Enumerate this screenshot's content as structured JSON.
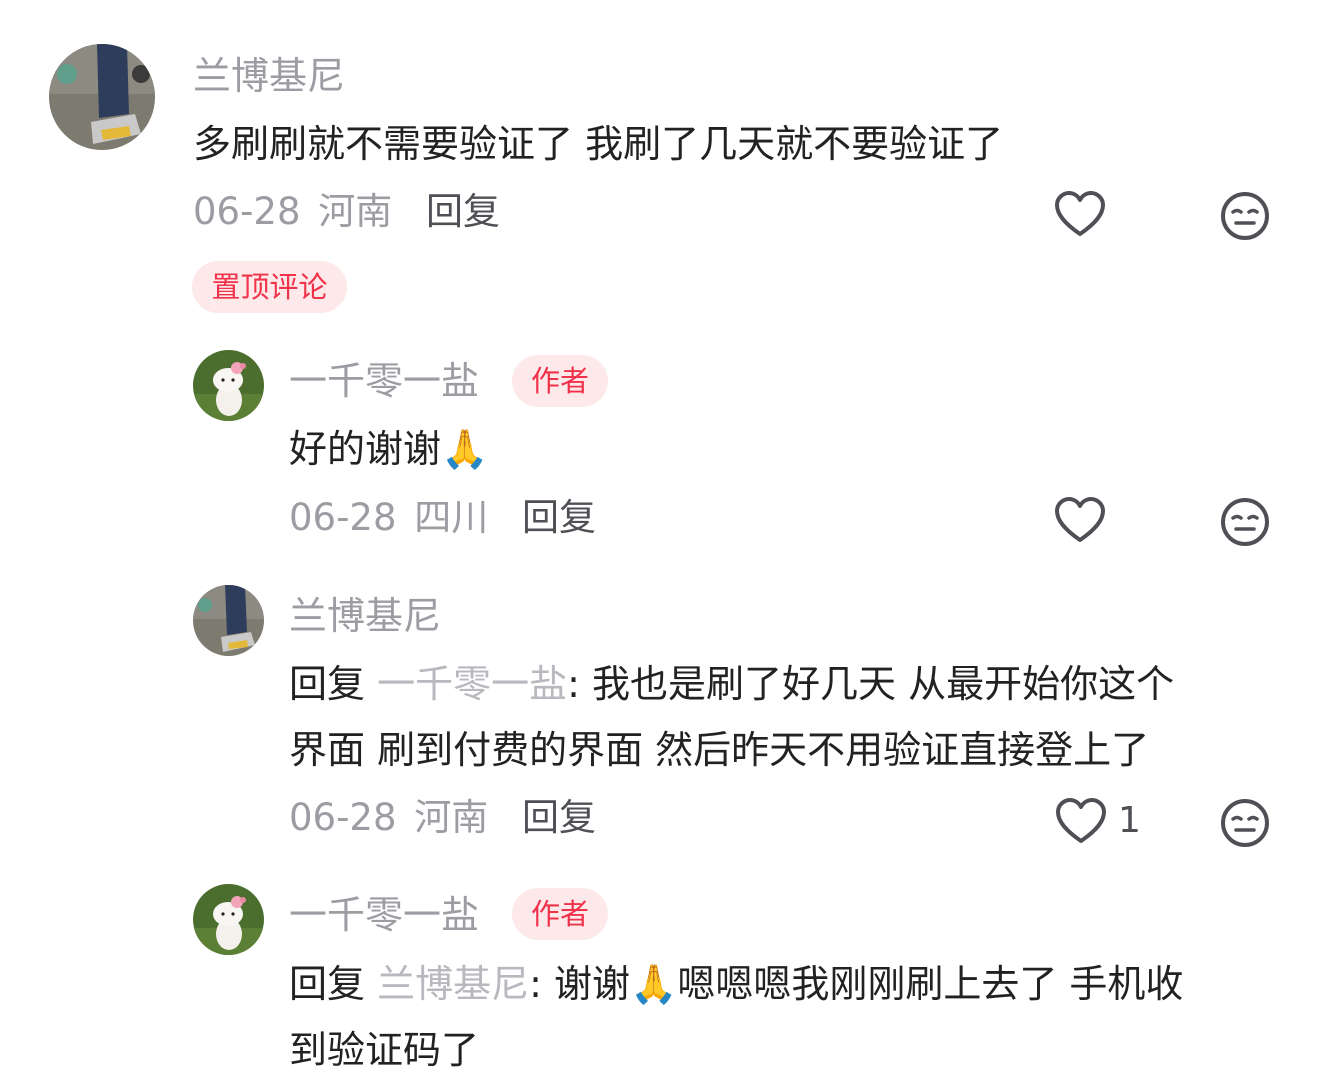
{
  "colors": {
    "text": "#222222",
    "muted": "#9c9ca3",
    "mention": "#b8b8be",
    "accent_red": "#f0324b",
    "badge_bg": "#fde9ea",
    "icon": "#4f4f55"
  },
  "icons": {
    "like": "heart-outline-icon",
    "dislike": "neutral-face-icon",
    "emoji": "folded-hands-emoji"
  },
  "comments": [
    {
      "author": "兰博基尼",
      "text": "多刷刷就不需要验证了 我刷了几天就不要验证了",
      "date": "06-28",
      "location": "河南",
      "reply_label": "回复",
      "pinned_label": "置顶评论",
      "like_count": ""
    },
    {
      "author": "一千零一盐",
      "author_badge": "作者",
      "text": "好的谢谢",
      "emoji": "🙏",
      "date": "06-28",
      "location": "四川",
      "reply_label": "回复",
      "like_count": ""
    },
    {
      "author": "兰博基尼",
      "reply_prefix": "回复",
      "mention": "一千零一盐",
      "text_line1": ": 我也是刷了好几天 从最开始你这个",
      "text_line2": "界面 刷到付费的界面 然后昨天不用验证直接登上了",
      "date": "06-28",
      "location": "河南",
      "reply_label": "回复",
      "like_count": "1"
    },
    {
      "author": "一千零一盐",
      "author_badge": "作者",
      "reply_prefix": "回复",
      "mention": "兰博基尼",
      "text_line1_a": ": 谢谢",
      "emoji": "🙏",
      "text_line1_b": "嗯嗯嗯我刚刚刷上去了 手机收",
      "text_line2": "到验证码了"
    }
  ]
}
